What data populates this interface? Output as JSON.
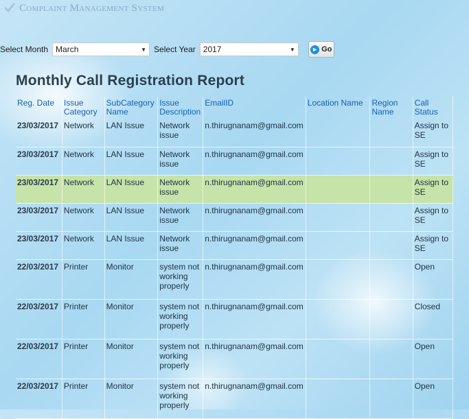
{
  "app": {
    "title": "Complaint Management System"
  },
  "filters": {
    "month_label": "Select Month",
    "month_value": "March",
    "year_label": "Select Year",
    "year_value": "2017",
    "go_label": "Go"
  },
  "report": {
    "title": "Monthly Call Registration Report",
    "columns": [
      "Reg. Date",
      "Issue Category",
      "SubCategory Name",
      "Issue Description",
      "EmailID",
      "Location Name",
      "Region Name",
      "Call Status"
    ],
    "rows": [
      {
        "date": "23/03/2017",
        "category": "Network",
        "subcategory": "LAN Issue",
        "description": "Network issue",
        "email": "n.thirugnanam@gmail.com",
        "location": "",
        "region": "",
        "status": "Assign to SE"
      },
      {
        "date": "23/03/2017",
        "category": "Network",
        "subcategory": "LAN Issue",
        "description": "Network issue",
        "email": "n.thirugnanam@gmail.com",
        "location": "",
        "region": "",
        "status": "Assign to SE"
      },
      {
        "date": "23/03/2017",
        "category": "Network",
        "subcategory": "LAN Issue",
        "description": "Network issue",
        "email": "n.thirugnanam@gmail.com",
        "location": "",
        "region": "",
        "status": "Assign to SE"
      },
      {
        "date": "23/03/2017",
        "category": "Network",
        "subcategory": "LAN Issue",
        "description": "Network issue",
        "email": "n.thirugnanam@gmail.com",
        "location": "",
        "region": "",
        "status": "Assign to SE"
      },
      {
        "date": "23/03/2017",
        "category": "Network",
        "subcategory": "LAN Issue",
        "description": "Network issue",
        "email": "n.thirugnanam@gmail.com",
        "location": "",
        "region": "",
        "status": "Assign to SE"
      },
      {
        "date": "22/03/2017",
        "category": "Printer",
        "subcategory": "Monitor",
        "description": "system not working properly",
        "email": "n.thirugnanam@gmail.com",
        "location": "",
        "region": "",
        "status": "Open"
      },
      {
        "date": "22/03/2017",
        "category": "Printer",
        "subcategory": "Monitor",
        "description": "system not working properly",
        "email": "n.thirugnanam@gmail.com",
        "location": "",
        "region": "",
        "status": "Closed"
      },
      {
        "date": "22/03/2017",
        "category": "Printer",
        "subcategory": "Monitor",
        "description": "system not working properly",
        "email": "n.thirugnanam@gmail.com",
        "location": "",
        "region": "",
        "status": "Open"
      },
      {
        "date": "22/03/2017",
        "category": "Printer",
        "subcategory": "Monitor",
        "description": "system not working properly",
        "email": "n.thirugnanam@gmail.com",
        "location": "",
        "region": "",
        "status": "Open"
      }
    ]
  },
  "colors": {
    "header_text": "#1560b5",
    "highlight_row": "#c6e3a9",
    "title_text": "#2a3f4c",
    "app_title": "#8aa9c6"
  },
  "icons": {
    "app": "check-icon",
    "go": "arrow-circle-icon",
    "dropdown": "chevron-down-icon"
  }
}
